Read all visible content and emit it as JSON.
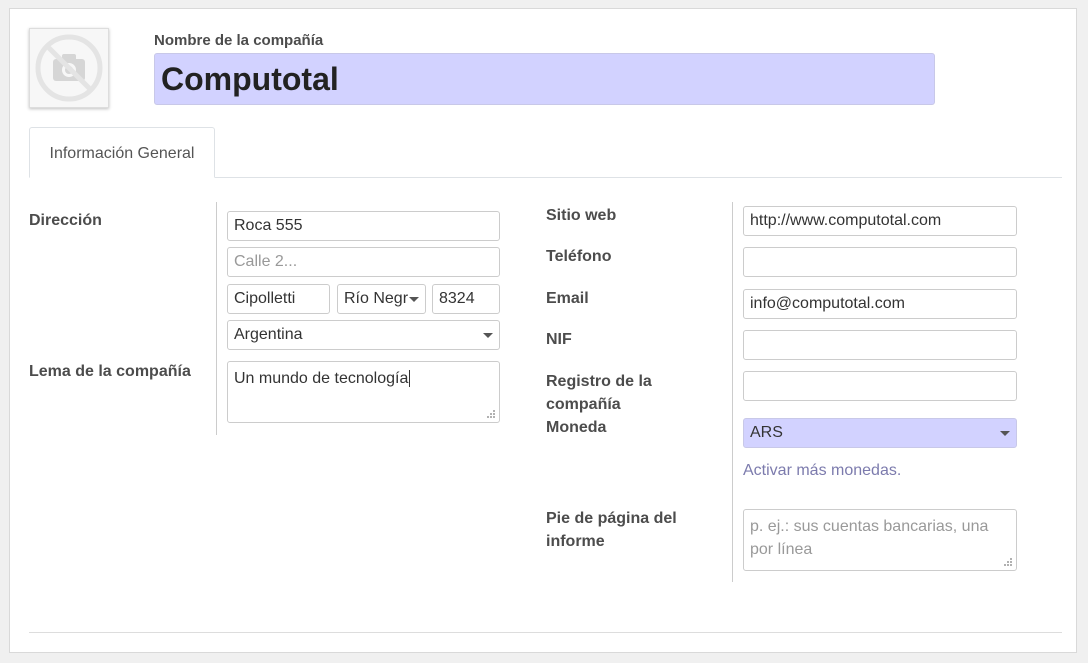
{
  "company": {
    "name_label": "Nombre de la compañía",
    "name_value": "Computotal"
  },
  "tabs": [
    {
      "label": "Información General"
    }
  ],
  "address": {
    "label": "Dirección",
    "street": "Roca 555",
    "street2_placeholder": "Calle 2...",
    "city": "Cipolletti",
    "state": "Río Negr",
    "zip": "8324",
    "country": "Argentina"
  },
  "motto": {
    "label": "Lema de la compañía",
    "value": "Un mundo de tecnología"
  },
  "website": {
    "label": "Sitio web",
    "value": "http://www.computotal.com"
  },
  "phone": {
    "label": "Teléfono",
    "value": ""
  },
  "email": {
    "label": "Email",
    "value": "info@computotal.com"
  },
  "vat": {
    "label": "NIF",
    "value": ""
  },
  "company_registry": {
    "label_line1": "Registro de la",
    "label_line2": "compañía",
    "value": ""
  },
  "currency": {
    "label": "Moneda",
    "value": "ARS",
    "link": "Activar más monedas."
  },
  "report_footer": {
    "label_line1": "Pie de página del",
    "label_line2": "informe",
    "placeholder": "p. ej.: sus cuentas bancarias, una por línea"
  },
  "colors": {
    "required_field": "#d2d2ff",
    "link": "#7c7bad"
  }
}
